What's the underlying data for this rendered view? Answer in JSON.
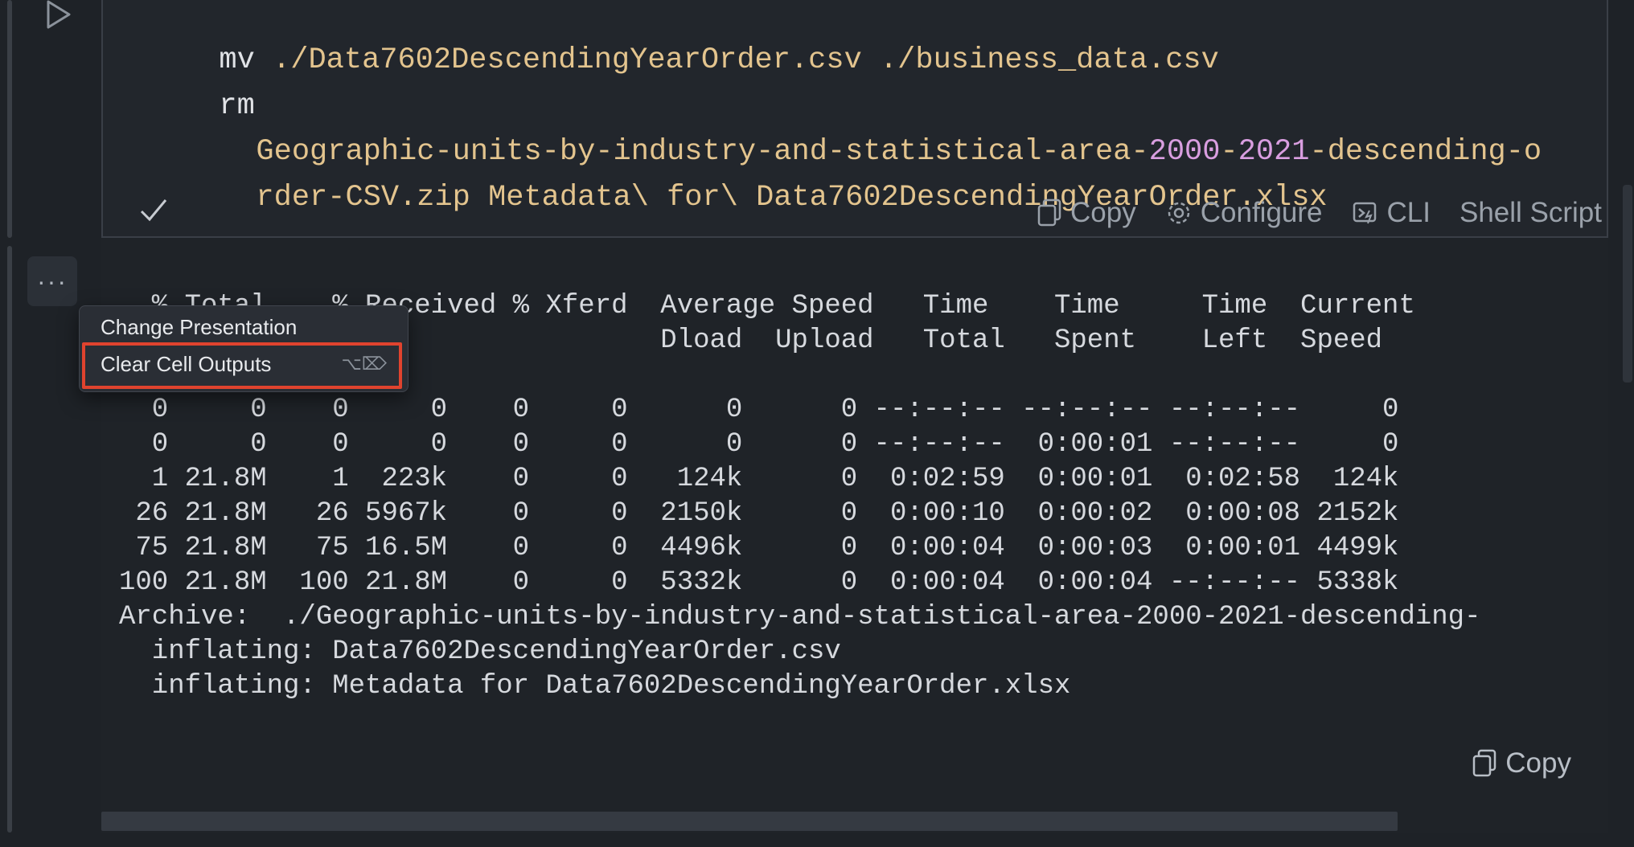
{
  "code": {
    "lines": [
      {
        "cmd": "mv ",
        "arg": "./Data7602DescendingYearOrder.csv ./business_data.csv"
      },
      {
        "cmd": "rm",
        "arg": ""
      },
      {
        "pre": "Geographic-units-by-industry-and-statistical-area-",
        "num1": "2000",
        "mid": "-",
        "num2": "2021",
        "post": "-descending-o"
      },
      {
        "arg": "rder-CSV.zip Metadata\\ for\\ Data7602DescendingYearOrder.xlsx"
      }
    ],
    "status_icon": "check-icon",
    "toolbar": {
      "copy": "Copy",
      "configure": "Configure",
      "cli": "CLI",
      "shell_script": "Shell Script"
    }
  },
  "output": {
    "header1": "  % Total    % Received % Xferd  Average Speed   Time    Time     Time  Current",
    "header2": "                                 Dload  Upload   Total   Spent    Left  Speed",
    "rows": [
      "  0     0    0     0    0     0      0      0 --:--:-- --:--:-- --:--:--     0",
      "  0     0    0     0    0     0      0      0 --:--:--  0:00:01 --:--:--     0",
      "  1 21.8M    1  223k    0     0   124k      0  0:02:59  0:00:01  0:02:58  124k",
      " 26 21.8M   26 5967k    0     0  2150k      0  0:00:10  0:00:02  0:00:08 2152k",
      " 75 21.8M   75 16.5M    0     0  4496k      0  0:00:04  0:00:03  0:00:01 4499k",
      "100 21.8M  100 21.8M    0     0  5332k      0  0:00:04  0:00:04 --:--:-- 5338k",
      "Archive:  ./Geographic-units-by-industry-and-statistical-area-2000-2021-descending-",
      "  inflating: Data7602DescendingYearOrder.csv",
      "  inflating: Metadata for Data7602DescendingYearOrder.xlsx"
    ],
    "copy_label": "Copy"
  },
  "context_menu": {
    "items": [
      {
        "label": "Change Presentation"
      },
      {
        "label": "Clear Cell Outputs",
        "shortcut": "⌥⌦"
      }
    ]
  },
  "colors": {
    "highlight": "#e0432e",
    "string": "#e3c48e",
    "number": "#d99ee0"
  }
}
